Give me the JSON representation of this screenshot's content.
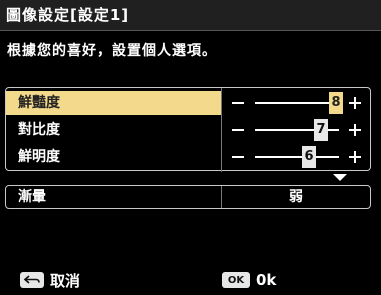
{
  "header": {
    "title": "圖像設定[設定1]"
  },
  "instruction": "根據您的喜好，設置個人選項。",
  "settings": [
    {
      "label": "鮮豔度",
      "value": "8",
      "selected": true
    },
    {
      "label": "對比度",
      "value": "7",
      "selected": false
    },
    {
      "label": "鮮明度",
      "value": "6",
      "selected": false
    }
  ],
  "gradation": {
    "label": "漸暈",
    "value": "弱"
  },
  "footer": {
    "cancel_label": "取消",
    "ok_key": "OK",
    "ok_label": "0k"
  },
  "icons": {
    "more_below": "triangle-down-icon",
    "back_key": "return-arrow-icon"
  },
  "colors": {
    "highlight": "#f2d98c",
    "background": "#000000"
  }
}
